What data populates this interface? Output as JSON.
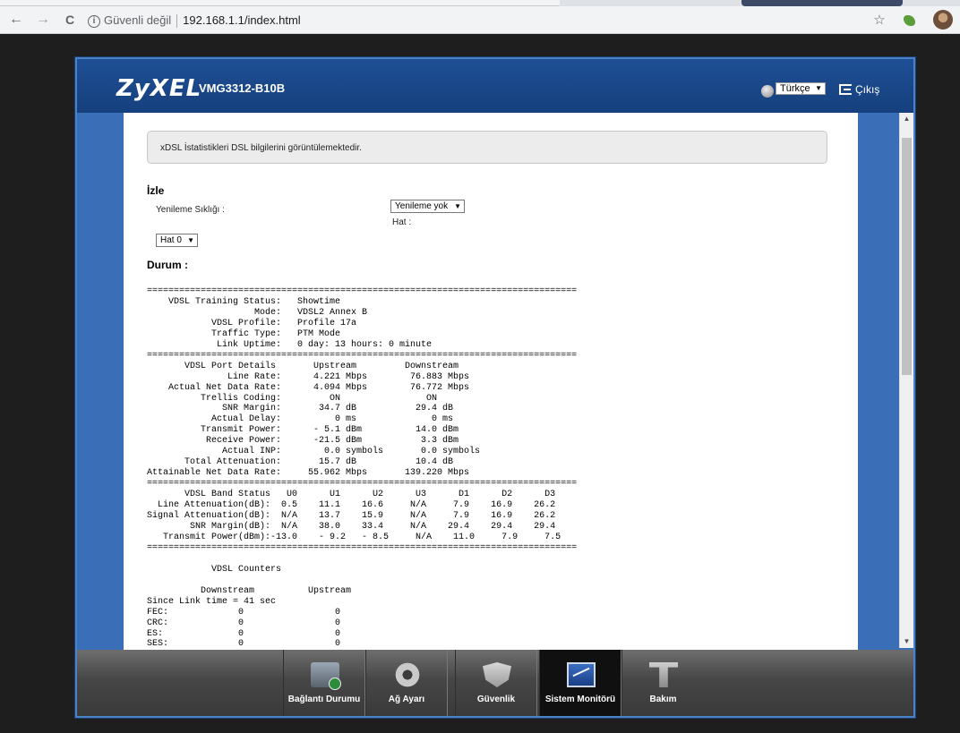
{
  "browser": {
    "back": "←",
    "forward": "→",
    "reload": "C",
    "security": "Güvenli değil",
    "url": "192.168.1.1/index.html",
    "star": "☆"
  },
  "header": {
    "logo": "ZyXEL",
    "model": "VMG3312-B10B",
    "language": "Türkçe",
    "logout": "Çıkış"
  },
  "content": {
    "notice": "xDSL İstatistikleri DSL bilgilerini görüntülemektedir.",
    "monitor_title": "İzle",
    "refresh_label": "Yenileme Sıklığı :",
    "refresh_value": "Yenileme yok",
    "line_label": "Hat :",
    "line_value": "Hat 0",
    "status_title": "Durum :",
    "status_lines": [
      "================================================================================",
      "    VDSL Training Status:   Showtime",
      "                    Mode:   VDSL2 Annex B",
      "            VDSL Profile:   Profile 17a",
      "            Traffic Type:   PTM Mode",
      "             Link Uptime:   0 day: 13 hours: 0 minute",
      "================================================================================",
      "       VDSL Port Details       Upstream         Downstream",
      "               Line Rate:      4.221 Mbps        76.883 Mbps",
      "    Actual Net Data Rate:      4.094 Mbps        76.772 Mbps",
      "          Trellis Coding:         ON                ON",
      "              SNR Margin:       34.7 dB           29.4 dB",
      "            Actual Delay:          0 ms              0 ms",
      "          Transmit Power:      - 5.1 dBm          14.0 dBm",
      "           Receive Power:      -21.5 dBm           3.3 dBm",
      "              Actual INP:        0.0 symbols       0.0 symbols",
      "       Total Attenuation:       15.7 dB           10.4 dB",
      "Attainable Net Data Rate:     55.962 Mbps       139.220 Mbps",
      "================================================================================",
      "       VDSL Band Status   U0      U1      U2      U3      D1      D2      D3",
      "  Line Attenuation(dB):  0.5    11.1    16.6     N/A     7.9    16.9    26.2",
      "Signal Attenuation(dB):  N/A    13.7    15.9     N/A     7.9    16.9    26.2",
      "        SNR Margin(dB):  N/A    38.0    33.4     N/A    29.4    29.4    29.4",
      "   Transmit Power(dBm):-13.0    - 9.2   - 8.5     N/A    11.0     7.9     7.5",
      "================================================================================",
      "",
      "            VDSL Counters",
      "",
      "          Downstream          Upstream",
      "Since Link time = 41 sec",
      "FEC:             0                 0",
      "CRC:             0                 0",
      "ES:              0                 0",
      "SES:             0                 0"
    ]
  },
  "nav": {
    "items": [
      {
        "label": "Bağlantı Durumu",
        "icon": "connection-status-icon"
      },
      {
        "label": "Ağ Ayarı",
        "icon": "gear-icon"
      },
      {
        "label": "Güvenlik",
        "icon": "shield-icon"
      },
      {
        "label": "Sistem Monitörü",
        "icon": "chart-monitor-icon"
      },
      {
        "label": "Bakım",
        "icon": "maintenance-icon"
      }
    ],
    "active": "Sistem Monitörü"
  },
  "colors": {
    "header_blue": "#1e4f95",
    "frame_blue": "#3a6fb8",
    "nav_dark": "#3a3a3a",
    "nav_active": "#101010"
  }
}
